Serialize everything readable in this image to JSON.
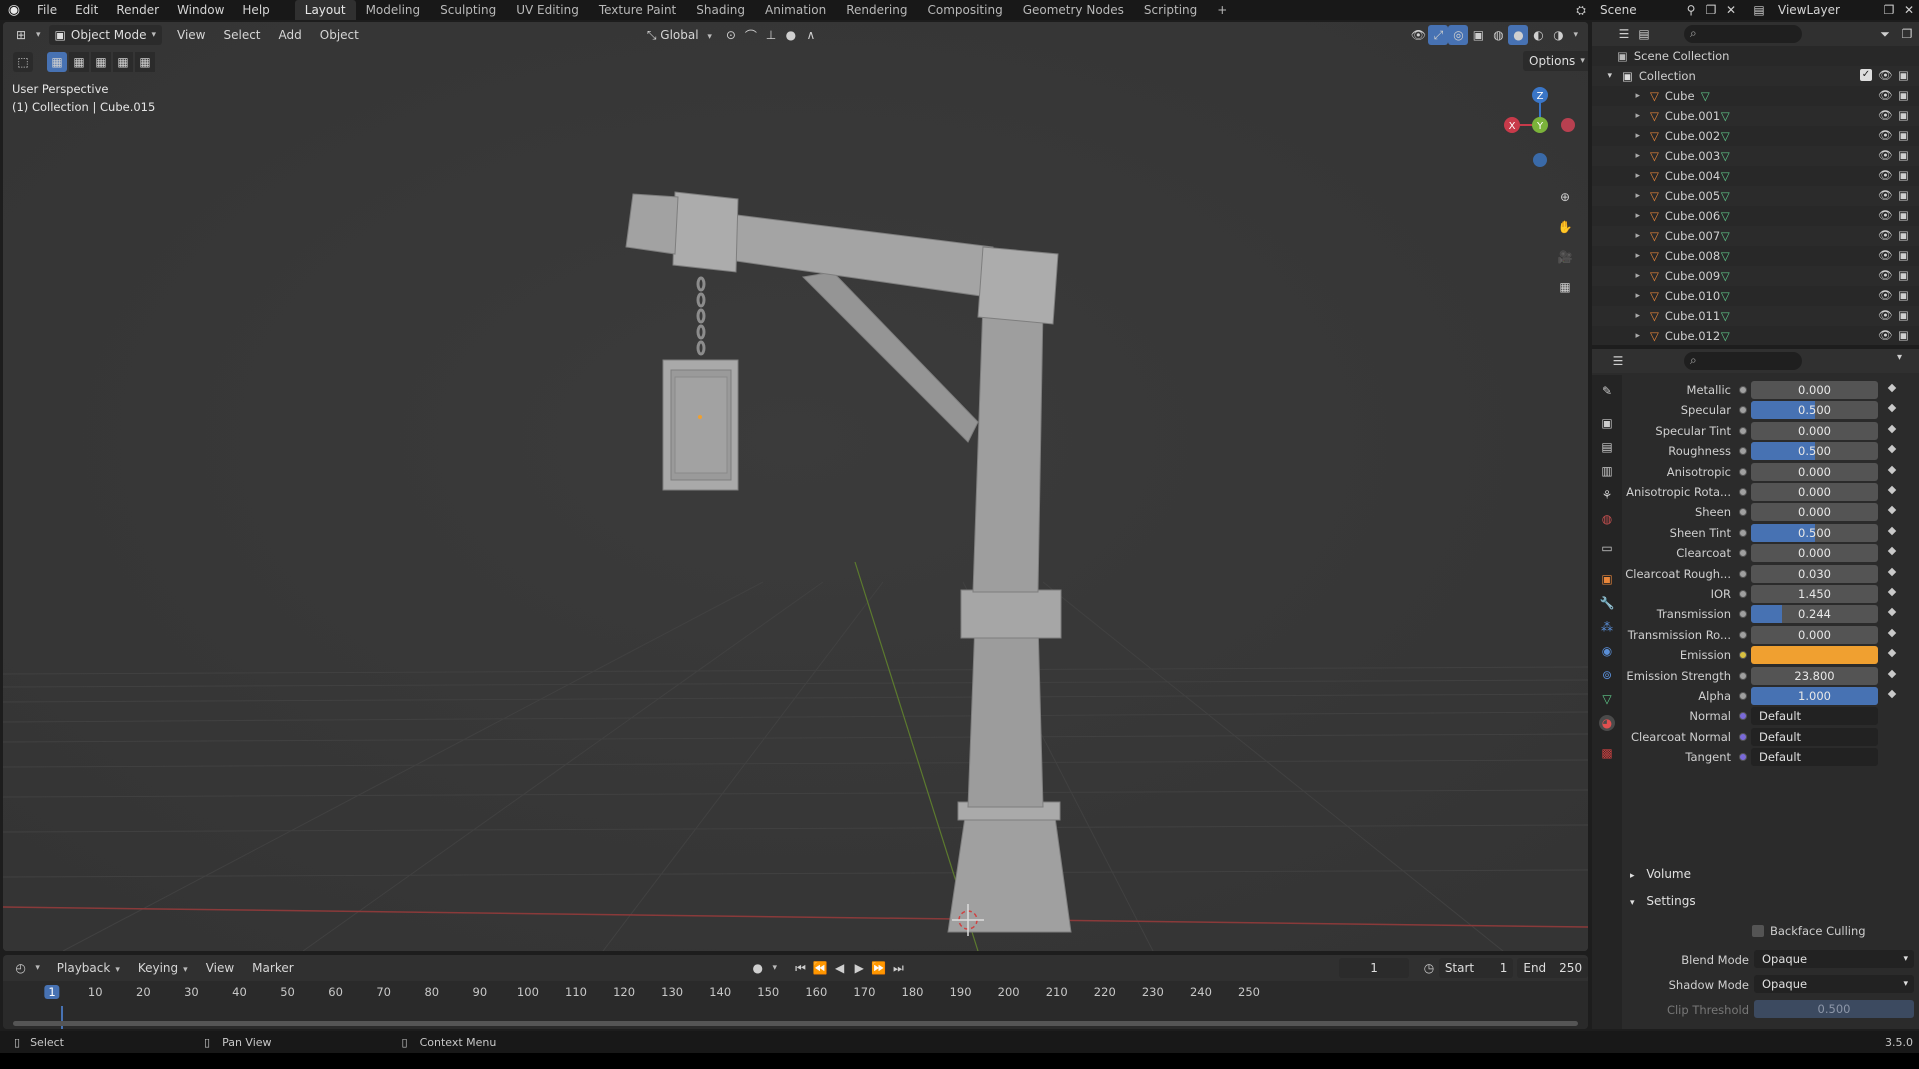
{
  "topbar": {
    "menus": [
      "File",
      "Edit",
      "Render",
      "Window",
      "Help"
    ],
    "workspaces": [
      "Layout",
      "Modeling",
      "Sculpting",
      "UV Editing",
      "Texture Paint",
      "Shading",
      "Animation",
      "Rendering",
      "Compositing",
      "Geometry Nodes",
      "Scripting"
    ],
    "active_workspace": "Layout",
    "add_tab": "+",
    "scene": "Scene",
    "view_layer": "ViewLayer"
  },
  "viewport": {
    "mode": "Object Mode",
    "menus": [
      "View",
      "Select",
      "Add",
      "Object"
    ],
    "transform_orientation": "Global",
    "options_label": "Options",
    "overlay_line1": "User Perspective",
    "overlay_line2": "(1) Collection | Cube.015",
    "gizmo": {
      "z": "Z",
      "y": "Y",
      "x": "X"
    }
  },
  "outliner": {
    "scene_collection": "Scene Collection",
    "collection": "Collection",
    "objects": [
      "Cube",
      "Cube.001",
      "Cube.002",
      "Cube.003",
      "Cube.004",
      "Cube.005",
      "Cube.006",
      "Cube.007",
      "Cube.008",
      "Cube.009",
      "Cube.010",
      "Cube.011",
      "Cube.012"
    ]
  },
  "properties": {
    "rows": [
      {
        "label": "Metallic",
        "value": "0.000",
        "fill": 0
      },
      {
        "label": "Specular",
        "value": "0.500",
        "fill": 0.5
      },
      {
        "label": "Specular Tint",
        "value": "0.000",
        "fill": 0
      },
      {
        "label": "Roughness",
        "value": "0.500",
        "fill": 0.5
      },
      {
        "label": "Anisotropic",
        "value": "0.000",
        "fill": 0
      },
      {
        "label": "Anisotropic Rota...",
        "value": "0.000",
        "fill": 0
      },
      {
        "label": "Sheen",
        "value": "0.000",
        "fill": 0
      },
      {
        "label": "Sheen Tint",
        "value": "0.500",
        "fill": 0.5
      },
      {
        "label": "Clearcoat",
        "value": "0.000",
        "fill": 0
      },
      {
        "label": "Clearcoat Rough...",
        "value": "0.030",
        "fill": 0
      },
      {
        "label": "IOR",
        "value": "1.450",
        "fill": 0
      },
      {
        "label": "Transmission",
        "value": "0.244",
        "fill": 0.244
      },
      {
        "label": "Transmission Ro...",
        "value": "0.000",
        "fill": 0
      },
      {
        "label": "Emission",
        "value": "",
        "color": "#f0a030"
      },
      {
        "label": "Emission Strength",
        "value": "23.800",
        "fill": 0
      },
      {
        "label": "Alpha",
        "value": "1.000",
        "fill": 1
      }
    ],
    "vector_rows": [
      {
        "label": "Normal",
        "value": "Default"
      },
      {
        "label": "Clearcoat Normal",
        "value": "Default"
      },
      {
        "label": "Tangent",
        "value": "Default"
      }
    ],
    "volume_label": "Volume",
    "settings_label": "Settings",
    "backface_culling": "Backface Culling",
    "blend_mode_label": "Blend Mode",
    "blend_mode": "Opaque",
    "shadow_mode_label": "Shadow Mode",
    "shadow_mode": "Opaque",
    "clip_threshold_label": "Clip Threshold",
    "clip_threshold": "0.500",
    "version": "3.5.0"
  },
  "timeline": {
    "menus": [
      "Playback",
      "Keying",
      "View",
      "Marker"
    ],
    "current_frame": "1",
    "start_label": "Start",
    "start": "1",
    "end_label": "End",
    "end": "250",
    "ticks": [
      "1",
      "10",
      "20",
      "30",
      "40",
      "50",
      "60",
      "70",
      "80",
      "90",
      "100",
      "110",
      "120",
      "130",
      "140",
      "150",
      "160",
      "170",
      "180",
      "190",
      "200",
      "210",
      "220",
      "230",
      "240",
      "250"
    ]
  },
  "statusbar": {
    "select": "Select",
    "pan": "Pan View",
    "context": "Context Menu"
  },
  "colors": {
    "accent_blue": "#4772b3",
    "emission": "#f0a030",
    "object_orange": "#e8863a",
    "mesh_green": "#5fc98a"
  }
}
